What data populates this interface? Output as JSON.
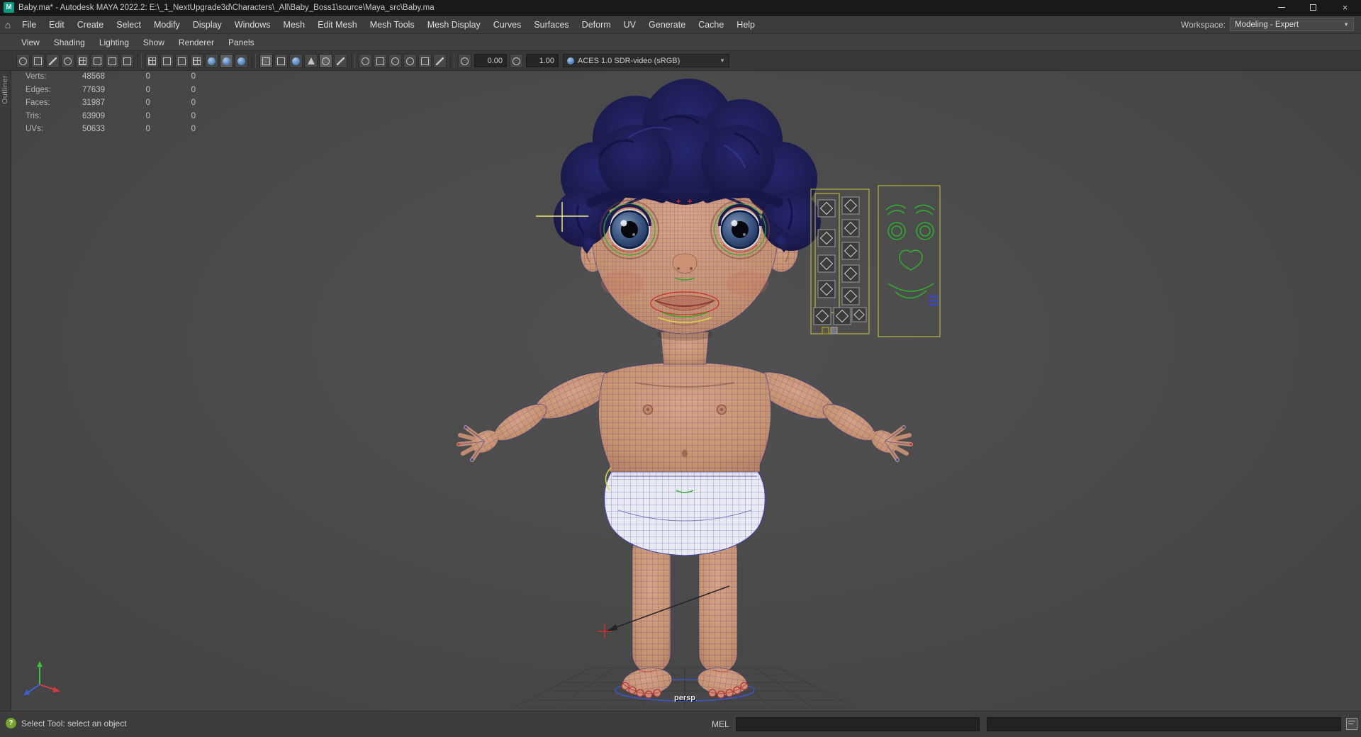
{
  "window": {
    "app_badge": "M",
    "title": "Baby.ma* - Autodesk MAYA 2022.2: E:\\_1_NextUpgrade3d\\Characters\\_All\\Baby_Boss1\\source\\Maya_src\\Baby.ma"
  },
  "icons": {
    "dropdown": "▼",
    "close": "×",
    "home": "⌂",
    "help": "?"
  },
  "menu_bar": {
    "items": [
      "File",
      "Edit",
      "Create",
      "Select",
      "Modify",
      "Display",
      "Windows",
      "Mesh",
      "Edit Mesh",
      "Mesh Tools",
      "Mesh Display",
      "Curves",
      "Surfaces",
      "Deform",
      "UV",
      "Generate",
      "Cache",
      "Help"
    ],
    "workspace_label": "Workspace:",
    "workspace_value": "Modeling - Expert"
  },
  "panel_menu": {
    "items": [
      "View",
      "Shading",
      "Lighting",
      "Show",
      "Renderer",
      "Panels"
    ]
  },
  "panel_toolbar": {
    "exposure": "0.00",
    "gamma": "1.00",
    "colorspace": "ACES 1.0 SDR-video (sRGB)"
  },
  "side_dock": {
    "tab": "Outliner"
  },
  "hud": {
    "rows": [
      {
        "label": "Verts:",
        "a": "48568",
        "b": "0",
        "c": "0"
      },
      {
        "label": "Edges:",
        "a": "77639",
        "b": "0",
        "c": "0"
      },
      {
        "label": "Faces:",
        "a": "31987",
        "b": "0",
        "c": "0"
      },
      {
        "label": "Tris:",
        "a": "63909",
        "b": "0",
        "c": "0"
      },
      {
        "label": "UVs:",
        "a": "50633",
        "b": "0",
        "c": "0"
      }
    ]
  },
  "viewport": {
    "camera_label": "persp"
  },
  "status_bar": {
    "help_text": "Select Tool: select an object",
    "mel_label": "MEL"
  }
}
